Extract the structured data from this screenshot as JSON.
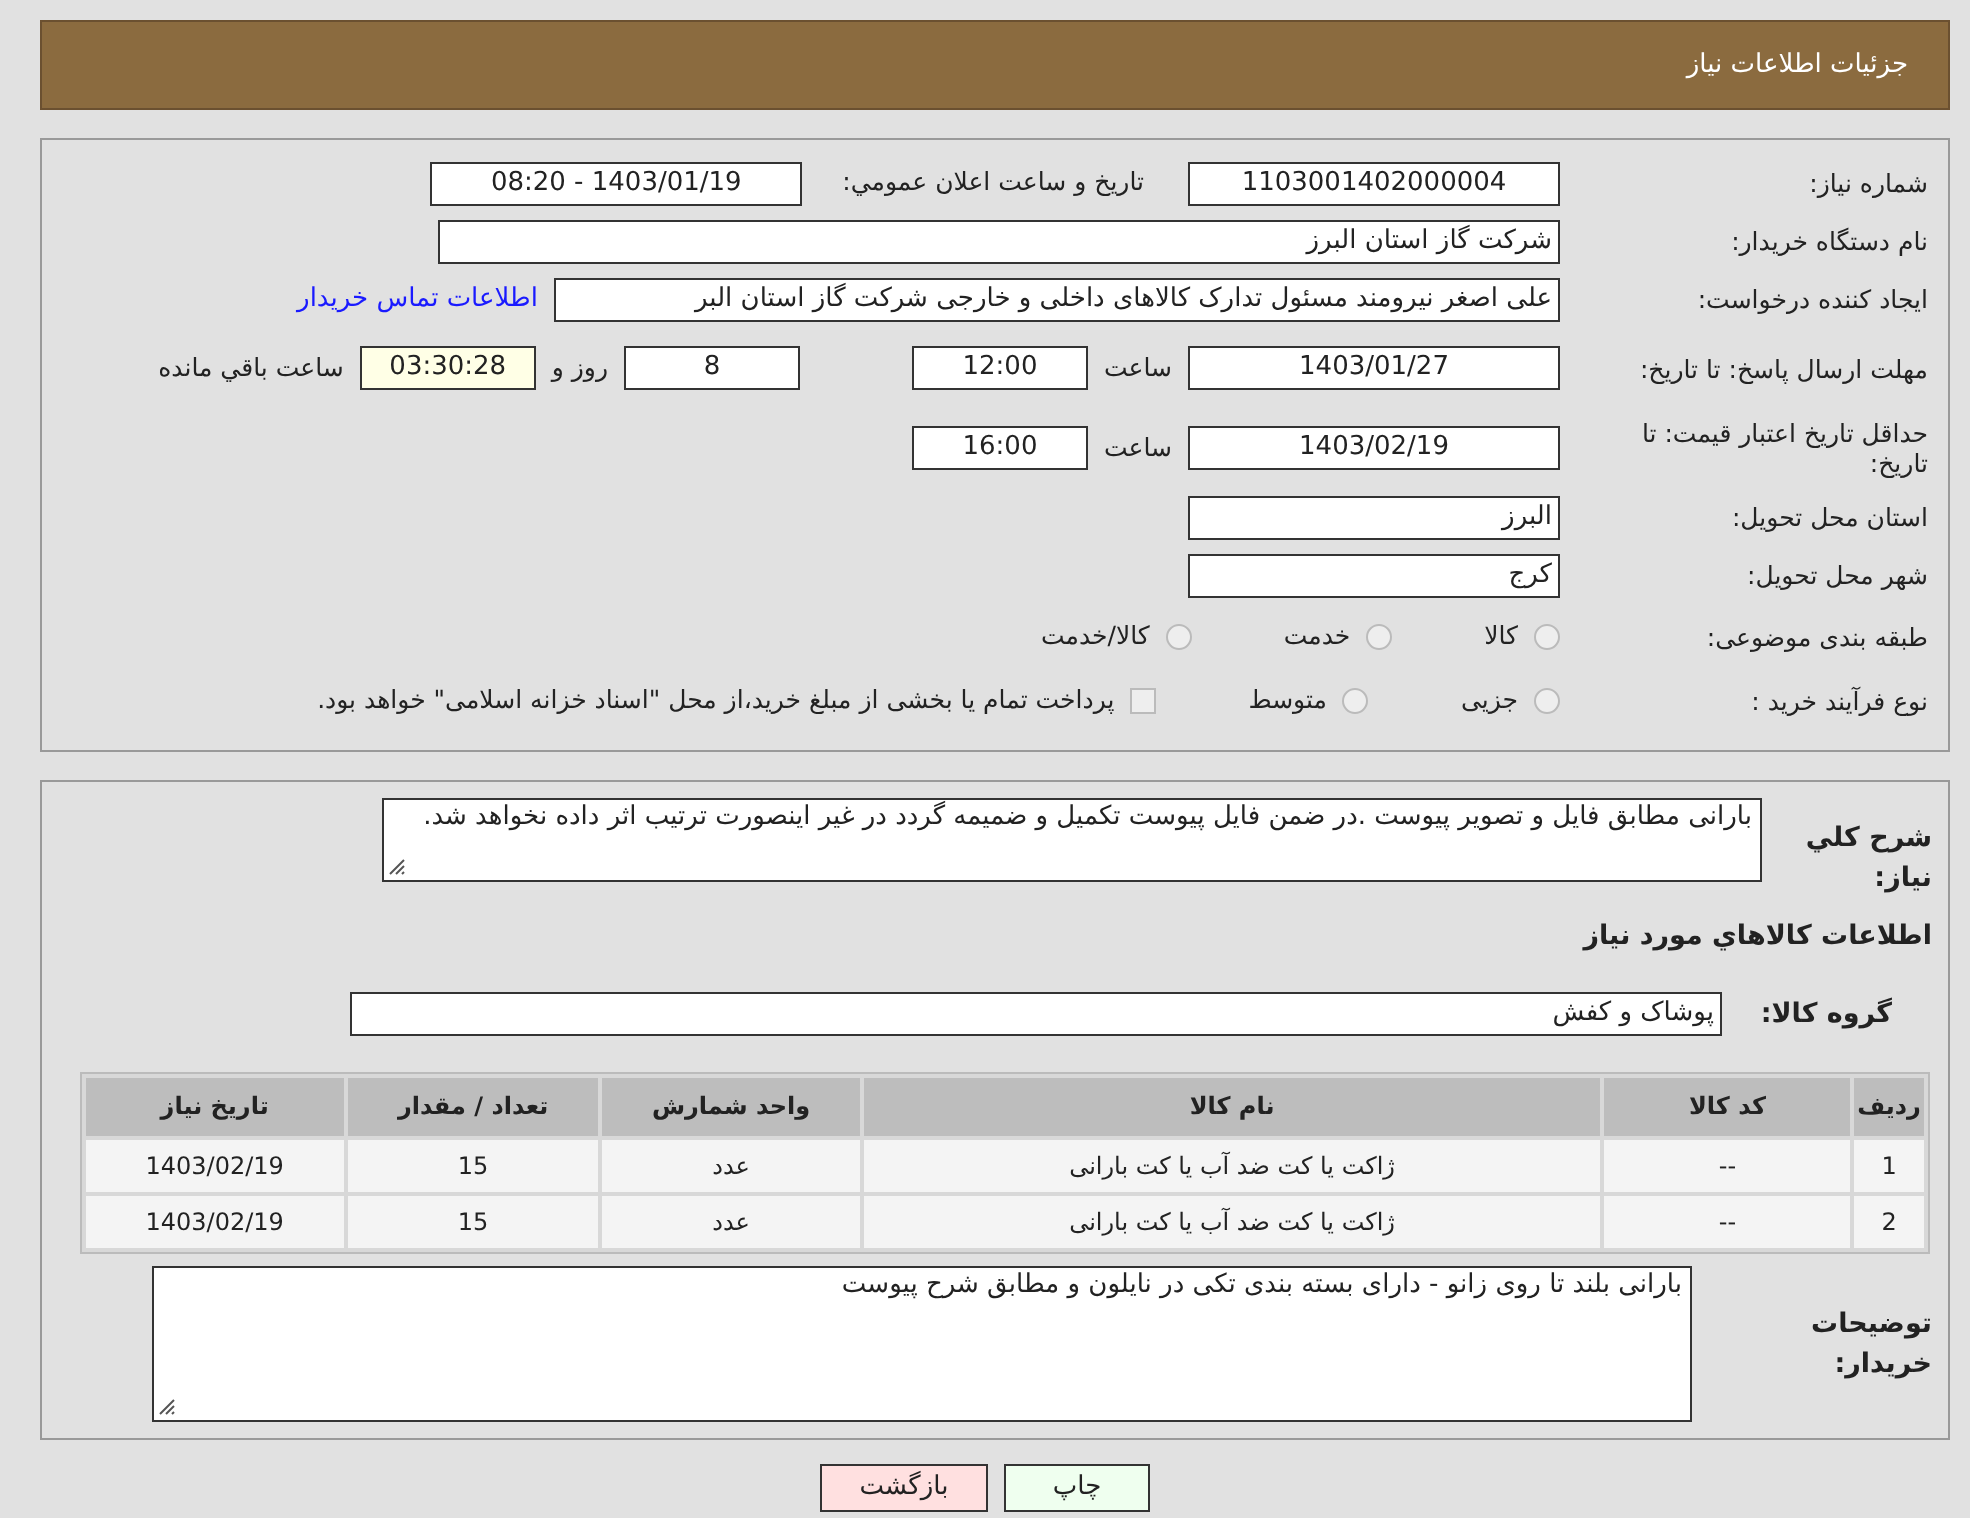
{
  "header": {
    "title": "جزئیات اطلاعات نیاز"
  },
  "form_rows": [
    {
      "kind": "pair",
      "label": "شماره نیاز:",
      "value": "1103001402000004",
      "label_2": "تاریخ و ساعت اعلان عمومي:",
      "value_2": "1403/01/19 - 08:20"
    },
    {
      "kind": "wide",
      "label": "نام دستگاه خریدار:",
      "value": "شرکت گاز استان البرز"
    },
    {
      "kind": "link",
      "label": "ایجاد کننده درخواست:",
      "value": "علی اصغر نیرومند مسئول تدارک کالاهای داخلی و خارجی شرکت گاز استان البر",
      "link": "اطلاعات تماس خریدار"
    },
    {
      "kind": "deadline",
      "label": "مهلت ارسال پاسخ: تا تاریخ:",
      "date": "1403/01/27",
      "time_label": "ساعت",
      "time": "12:00",
      "days": "8",
      "days_label": "روز و",
      "remaining": "03:30:28",
      "remaining_label": "ساعت باقي مانده"
    },
    {
      "kind": "validity",
      "label": "حداقل تاریخ اعتبار قیمت: تا تاریخ:",
      "date": "1403/02/19",
      "time_label": "ساعت",
      "time": "16:00"
    },
    {
      "kind": "short",
      "label": "استان محل تحویل:",
      "value": "البرز"
    },
    {
      "kind": "short",
      "label": "شهر محل تحویل:",
      "value": "کرج"
    },
    {
      "kind": "options",
      "label": "طبقه بندی موضوعی:",
      "options": [
        {
          "kind": "radio",
          "label": "کالا",
          "selected": false
        },
        {
          "kind": "radio",
          "label": "خدمت",
          "selected": false
        },
        {
          "kind": "radio",
          "label": "کالا/خدمت",
          "selected": false
        }
      ]
    },
    {
      "kind": "options",
      "label": "نوع فرآیند خرید :",
      "options": [
        {
          "kind": "radio",
          "label": "جزیی",
          "selected": false
        },
        {
          "kind": "radio",
          "label": "متوسط",
          "selected": false
        },
        {
          "kind": "checkbox",
          "label": "پرداخت تمام یا بخشی از مبلغ خرید،از محل \"اسناد خزانه اسلامی\" خواهد بود.",
          "checked": false
        }
      ]
    }
  ],
  "summary": {
    "label": "شرح کلي نیاز:",
    "value": "بارانی مطابق فایل و تصویر پیوست .در ضمن فایل پیوست تکمیل و ضمیمه گردد در غیر اینصورت ترتیب اثر داده نخواهد شد."
  },
  "goods_heading": "اطلاعات کالاهاي مورد نیاز",
  "goods_group": {
    "label": "گروه کالا:",
    "value": "پوشاک و کفش"
  },
  "table": {
    "columns": [
      "ردیف",
      "کد کالا",
      "نام کالا",
      "واحد شمارش",
      "تعداد / مقدار",
      "تاریخ نیاز"
    ],
    "rows": [
      [
        "1",
        "--",
        "ژاکت یا کت ضد آب یا کت بارانی",
        "عدد",
        "15",
        "1403/02/19"
      ],
      [
        "2",
        "--",
        "ژاکت یا کت ضد آب یا کت بارانی",
        "عدد",
        "15",
        "1403/02/19"
      ]
    ]
  },
  "buyer_notes": {
    "label": "توضیحات خریدار:",
    "value": "بارانی بلند تا روی زانو - دارای بسته بندی تکی در نایلون و مطابق شرح پیوست"
  },
  "buttons": [
    {
      "kind": "print",
      "label": "چاپ"
    },
    {
      "kind": "back",
      "label": "بازگشت"
    }
  ]
}
